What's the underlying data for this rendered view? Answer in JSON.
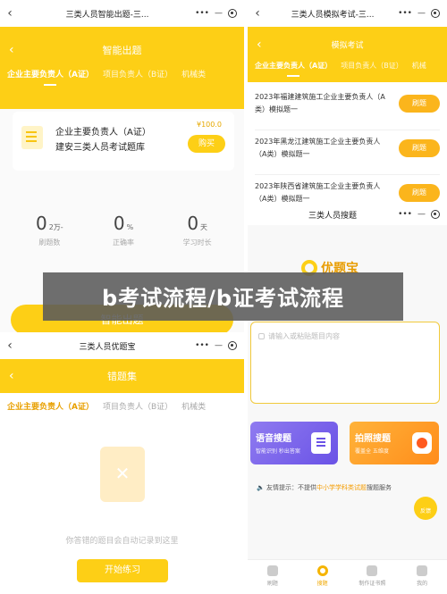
{
  "p1": {
    "title": "三类人员智能出题-三...",
    "header": "智能出题",
    "tabs": [
      "企业主要负责人（A证）",
      "项目负责人（B证）",
      "机械类"
    ],
    "card": {
      "line1": "企业主要负责人（A证）",
      "line2": "建安三类人员考试题库",
      "price": "¥100.0",
      "buy": "购买"
    },
    "stats": [
      {
        "num": "0",
        "unit": "2万-",
        "label": "刷题数"
      },
      {
        "num": "0",
        "unit": "%",
        "label": "正确率"
      },
      {
        "num": "0",
        "unit": "天",
        "label": "学习时长"
      }
    ],
    "button": "智能出题"
  },
  "p2": {
    "title": "三类人员模拟考试-三...",
    "header": "模拟考试",
    "tabs": [
      "企业主要负责人（A证）",
      "项目负责人（B证）",
      "机械"
    ],
    "items": [
      {
        "q": "2023年福建建筑施工企业主要负责人（A类）模拟题一",
        "btn": "刷题"
      },
      {
        "q": "2023年黑龙江建筑施工企业主要负责人（A类）模拟题一",
        "btn": "刷题"
      },
      {
        "q": "2023年陕西省建筑施工企业主要负责人（A类）模拟题一",
        "btn": "刷题"
      }
    ]
  },
  "p3": {
    "title": "三类人员搜题",
    "logo": "优题宝",
    "placeholder": "请输入或粘贴题目内容",
    "voice": {
      "title": "语音搜题",
      "sub": "智能识别 秒出答案"
    },
    "photo": {
      "title": "拍照搜题",
      "sub": "覆盖全 五维度"
    },
    "tip_pre": "友情提示：不提供",
    "tip_hl": "中小学学科类试题",
    "tip_post": "搜题服务",
    "float": "反馈",
    "tabbar": [
      "刷题",
      "搜题",
      "制作证书照",
      "我的"
    ]
  },
  "p4": {
    "title": "三类人员优题宝",
    "header": "错题集",
    "tabs": [
      "企业主要负责人（A证）",
      "项目负责人（B证）",
      "机械类"
    ],
    "empty_text": "你答错的题目会自动记录到这里",
    "button": "开始练习"
  },
  "banner": "b考试流程/b证考试流程"
}
